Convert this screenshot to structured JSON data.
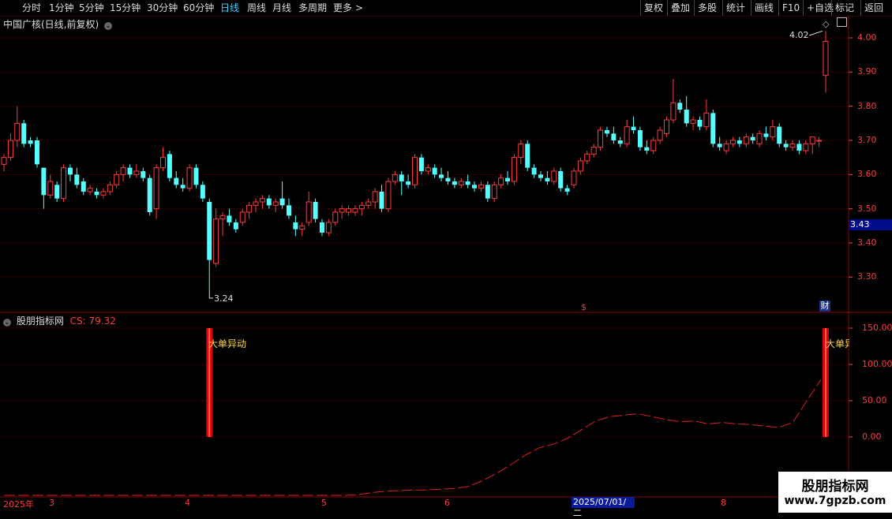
{
  "toolbar": {
    "periods": [
      "分时",
      "1分钟",
      "5分钟",
      "15分钟",
      "30分钟",
      "60分钟",
      "日线",
      "周线",
      "月线",
      "多周期",
      "更多"
    ],
    "active_period": "日线",
    "more_arrow": ">",
    "right_buttons": [
      "复权",
      "叠加",
      "多股",
      "统计",
      "画线",
      "F10",
      "+自选",
      "标记",
      "返回"
    ]
  },
  "main_chart": {
    "title": "中国广核(日线,前复权)",
    "price_ticks": [
      "4.00",
      "3.90",
      "3.80",
      "3.70",
      "3.60",
      "3.50",
      "3.40",
      "3.30"
    ],
    "last_price": "3.43",
    "high_annotation": "4.02",
    "low_annotation": "3.24",
    "marker_s": "$",
    "marker_cai": "财"
  },
  "indicator": {
    "name": "股朋指标网",
    "value_label": "CS: 79.32",
    "ticks": [
      "150.00",
      "100.00",
      "50.00",
      "0.00"
    ],
    "signal_text": "大单异动",
    "signal_text_clipped": "大单异"
  },
  "dates": {
    "year_label": "2025年",
    "months": [
      "3",
      "4",
      "5",
      "6",
      "8"
    ],
    "highlight": "2025/07/01/二"
  },
  "watermark": {
    "title": "股朋指标网",
    "url": "www.7gpzb.com"
  },
  "colors": {
    "up": "#ff3b3b",
    "down": "#54ffff",
    "active": "#3fd0ff",
    "signal_bar": "#e00000",
    "signal_text": "#ffd23f"
  },
  "chart_data": {
    "type": "candlestick",
    "title": "中国广核(日线,前复权)",
    "y_range": [
      3.2,
      4.05
    ],
    "y_ticks": [
      3.3,
      3.4,
      3.5,
      3.6,
      3.7,
      3.8,
      3.9,
      4.0
    ],
    "ohlc": [
      [
        3.63,
        3.66,
        3.61,
        3.65
      ],
      [
        3.65,
        3.72,
        3.64,
        3.7
      ],
      [
        3.7,
        3.8,
        3.68,
        3.75
      ],
      [
        3.75,
        3.76,
        3.68,
        3.69
      ],
      [
        3.7,
        3.71,
        3.68,
        3.69
      ],
      [
        3.7,
        3.71,
        3.62,
        3.63
      ],
      [
        3.62,
        3.62,
        3.5,
        3.54
      ],
      [
        3.54,
        3.6,
        3.53,
        3.58
      ],
      [
        3.57,
        3.58,
        3.52,
        3.53
      ],
      [
        3.53,
        3.63,
        3.52,
        3.62
      ],
      [
        3.62,
        3.63,
        3.58,
        3.6
      ],
      [
        3.6,
        3.62,
        3.56,
        3.57
      ],
      [
        3.58,
        3.59,
        3.54,
        3.55
      ],
      [
        3.55,
        3.57,
        3.54,
        3.56
      ],
      [
        3.55,
        3.56,
        3.53,
        3.54
      ],
      [
        3.54,
        3.56,
        3.53,
        3.55
      ],
      [
        3.55,
        3.58,
        3.54,
        3.57
      ],
      [
        3.57,
        3.61,
        3.56,
        3.6
      ],
      [
        3.6,
        3.63,
        3.58,
        3.62
      ],
      [
        3.62,
        3.63,
        3.59,
        3.6
      ],
      [
        3.6,
        3.63,
        3.59,
        3.61
      ],
      [
        3.61,
        3.62,
        3.58,
        3.59
      ],
      [
        3.59,
        3.6,
        3.48,
        3.49
      ],
      [
        3.5,
        3.63,
        3.47,
        3.62
      ],
      [
        3.62,
        3.68,
        3.61,
        3.65
      ],
      [
        3.66,
        3.67,
        3.58,
        3.59
      ],
      [
        3.59,
        3.61,
        3.56,
        3.57
      ],
      [
        3.57,
        3.59,
        3.55,
        3.56
      ],
      [
        3.56,
        3.63,
        3.55,
        3.62
      ],
      [
        3.62,
        3.63,
        3.56,
        3.57
      ],
      [
        3.57,
        3.58,
        3.52,
        3.53
      ],
      [
        3.52,
        3.53,
        3.26,
        3.35
      ],
      [
        3.34,
        3.5,
        3.33,
        3.47
      ],
      [
        3.47,
        3.49,
        3.42,
        3.48
      ],
      [
        3.48,
        3.5,
        3.45,
        3.46
      ],
      [
        3.46,
        3.47,
        3.43,
        3.44
      ],
      [
        3.46,
        3.5,
        3.45,
        3.49
      ],
      [
        3.49,
        3.52,
        3.47,
        3.51
      ],
      [
        3.51,
        3.53,
        3.49,
        3.52
      ],
      [
        3.52,
        3.54,
        3.5,
        3.53
      ],
      [
        3.53,
        3.54,
        3.5,
        3.51
      ],
      [
        3.51,
        3.53,
        3.49,
        3.52
      ],
      [
        3.53,
        3.58,
        3.5,
        3.51
      ],
      [
        3.51,
        3.53,
        3.47,
        3.48
      ],
      [
        3.46,
        3.48,
        3.42,
        3.44
      ],
      [
        3.44,
        3.46,
        3.42,
        3.45
      ],
      [
        3.46,
        3.55,
        3.45,
        3.52
      ],
      [
        3.52,
        3.53,
        3.46,
        3.47
      ],
      [
        3.46,
        3.47,
        3.42,
        3.43
      ],
      [
        3.43,
        3.47,
        3.42,
        3.46
      ],
      [
        3.46,
        3.5,
        3.45,
        3.49
      ],
      [
        3.49,
        3.51,
        3.47,
        3.5
      ],
      [
        3.49,
        3.51,
        3.48,
        3.5
      ],
      [
        3.49,
        3.51,
        3.48,
        3.5
      ],
      [
        3.5,
        3.52,
        3.48,
        3.51
      ],
      [
        3.51,
        3.53,
        3.5,
        3.52
      ],
      [
        3.52,
        3.56,
        3.5,
        3.55
      ],
      [
        3.55,
        3.57,
        3.49,
        3.5
      ],
      [
        3.5,
        3.59,
        3.49,
        3.58
      ],
      [
        3.58,
        3.61,
        3.57,
        3.6
      ],
      [
        3.6,
        3.61,
        3.54,
        3.58
      ],
      [
        3.58,
        3.6,
        3.56,
        3.57
      ],
      [
        3.57,
        3.66,
        3.56,
        3.65
      ],
      [
        3.65,
        3.66,
        3.6,
        3.61
      ],
      [
        3.61,
        3.63,
        3.6,
        3.62
      ],
      [
        3.62,
        3.63,
        3.59,
        3.6
      ],
      [
        3.6,
        3.62,
        3.58,
        3.59
      ],
      [
        3.59,
        3.61,
        3.57,
        3.58
      ],
      [
        3.58,
        3.59,
        3.56,
        3.57
      ],
      [
        3.57,
        3.59,
        3.56,
        3.58
      ],
      [
        3.58,
        3.6,
        3.56,
        3.57
      ],
      [
        3.57,
        3.58,
        3.55,
        3.56
      ],
      [
        3.56,
        3.58,
        3.55,
        3.57
      ],
      [
        3.57,
        3.58,
        3.52,
        3.53
      ],
      [
        3.53,
        3.58,
        3.52,
        3.57
      ],
      [
        3.57,
        3.6,
        3.56,
        3.59
      ],
      [
        3.59,
        3.61,
        3.57,
        3.58
      ],
      [
        3.58,
        3.66,
        3.57,
        3.65
      ],
      [
        3.65,
        3.7,
        3.63,
        3.69
      ],
      [
        3.69,
        3.7,
        3.61,
        3.62
      ],
      [
        3.62,
        3.63,
        3.59,
        3.6
      ],
      [
        3.6,
        3.61,
        3.58,
        3.59
      ],
      [
        3.59,
        3.61,
        3.57,
        3.58
      ],
      [
        3.58,
        3.62,
        3.57,
        3.61
      ],
      [
        3.61,
        3.62,
        3.55,
        3.56
      ],
      [
        3.56,
        3.57,
        3.54,
        3.55
      ],
      [
        3.57,
        3.62,
        3.56,
        3.61
      ],
      [
        3.61,
        3.65,
        3.6,
        3.64
      ],
      [
        3.64,
        3.67,
        3.63,
        3.66
      ],
      [
        3.66,
        3.69,
        3.65,
        3.68
      ],
      [
        3.68,
        3.74,
        3.67,
        3.73
      ],
      [
        3.73,
        3.74,
        3.71,
        3.72
      ],
      [
        3.72,
        3.74,
        3.69,
        3.7
      ],
      [
        3.7,
        3.71,
        3.68,
        3.69
      ],
      [
        3.69,
        3.76,
        3.68,
        3.74
      ],
      [
        3.74,
        3.77,
        3.72,
        3.73
      ],
      [
        3.73,
        3.74,
        3.67,
        3.68
      ],
      [
        3.68,
        3.7,
        3.66,
        3.67
      ],
      [
        3.67,
        3.71,
        3.66,
        3.7
      ],
      [
        3.7,
        3.74,
        3.69,
        3.73
      ],
      [
        3.72,
        3.77,
        3.71,
        3.76
      ],
      [
        3.76,
        3.88,
        3.75,
        3.81
      ],
      [
        3.81,
        3.82,
        3.78,
        3.79
      ],
      [
        3.79,
        3.83,
        3.74,
        3.75
      ],
      [
        3.75,
        3.77,
        3.73,
        3.76
      ],
      [
        3.76,
        3.77,
        3.73,
        3.74
      ],
      [
        3.74,
        3.82,
        3.73,
        3.78
      ],
      [
        3.78,
        3.79,
        3.68,
        3.69
      ],
      [
        3.69,
        3.71,
        3.67,
        3.68
      ],
      [
        3.67,
        3.7,
        3.66,
        3.69
      ],
      [
        3.69,
        3.71,
        3.68,
        3.7
      ],
      [
        3.7,
        3.71,
        3.68,
        3.69
      ],
      [
        3.69,
        3.72,
        3.68,
        3.71
      ],
      [
        3.71,
        3.72,
        3.69,
        3.7
      ],
      [
        3.69,
        3.73,
        3.68,
        3.72
      ],
      [
        3.72,
        3.74,
        3.7,
        3.71
      ],
      [
        3.71,
        3.76,
        3.7,
        3.74
      ],
      [
        3.74,
        3.75,
        3.68,
        3.69
      ],
      [
        3.69,
        3.7,
        3.67,
        3.68
      ],
      [
        3.68,
        3.7,
        3.67,
        3.69
      ],
      [
        3.69,
        3.7,
        3.66,
        3.67
      ],
      [
        3.67,
        3.7,
        3.66,
        3.69
      ],
      [
        3.69,
        3.71,
        3.66,
        3.71
      ],
      [
        3.7,
        3.71,
        3.68,
        3.7
      ],
      [
        3.89,
        4.02,
        3.84,
        3.99
      ]
    ],
    "indicator_series": {
      "name": "CS",
      "ylim": [
        -120,
        160
      ],
      "values": [
        -130,
        -125,
        -122,
        -124,
        -127,
        -129,
        -130,
        -130,
        -128,
        -128,
        -127,
        -126,
        -124,
        -121,
        -116,
        -110,
        -107,
        -104,
        -103,
        -101,
        -98,
        -94,
        -91,
        -88,
        -85,
        -80,
        -77,
        -75,
        -74,
        -73,
        -73,
        -72,
        -71,
        -68,
        -60,
        -50,
        -38,
        -25,
        -15,
        -10,
        -2,
        10,
        22,
        28,
        30,
        32,
        28,
        24,
        21,
        22,
        18,
        20,
        18,
        17,
        15,
        13,
        20,
        50,
        79
      ]
    },
    "signals": [
      {
        "index": 31,
        "label": "大单异动"
      },
      {
        "index": 124,
        "label": "大单异动"
      }
    ]
  }
}
